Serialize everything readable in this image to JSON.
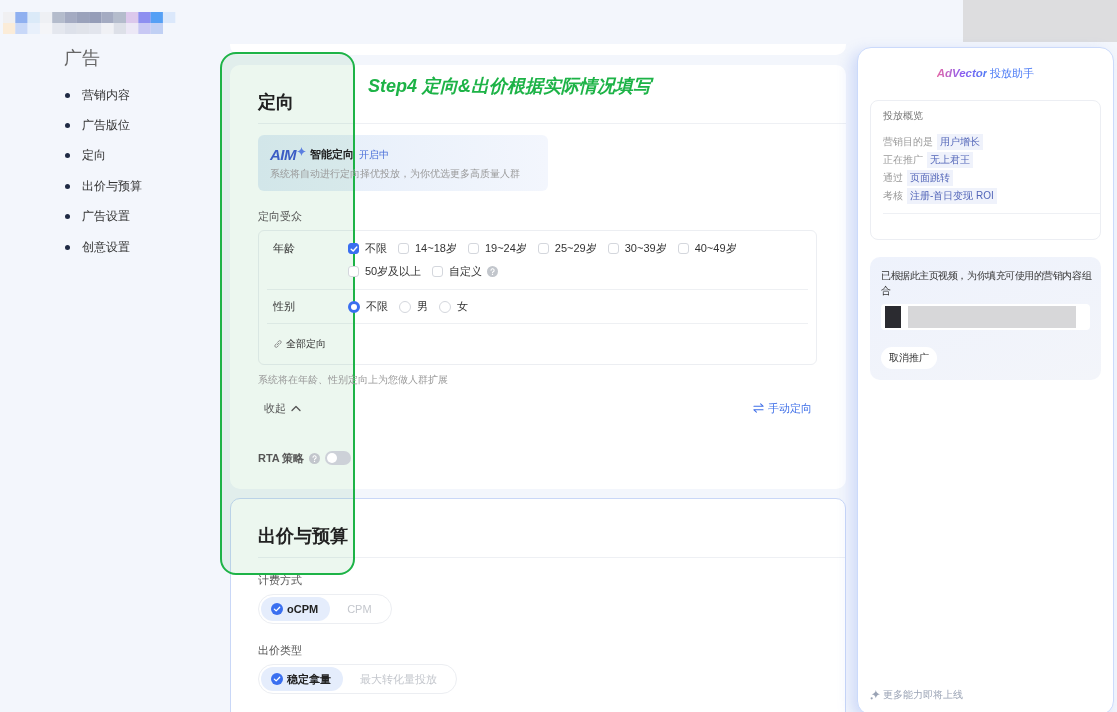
{
  "sidebar": {
    "title": "广告",
    "items": [
      "营销内容",
      "广告版位",
      "定向",
      "出价与预算",
      "广告设置",
      "创意设置"
    ]
  },
  "annotation": {
    "text": "Step4 定向&出价根据实际情况填写"
  },
  "targeting": {
    "title": "定向",
    "smart": {
      "logo": "AIM",
      "name": "智能定向",
      "status": "开启中",
      "description": "系统将自动进行定向择优投放，为你优选更多高质量人群"
    },
    "audience_label": "定向受众",
    "groups": [
      {
        "kind": "checkbox",
        "label": "年龄",
        "options": [
          {
            "label": "不限",
            "checked": true,
            "help": false
          },
          {
            "label": "14~18岁",
            "checked": false,
            "help": false
          },
          {
            "label": "19~24岁",
            "checked": false,
            "help": false
          },
          {
            "label": "25~29岁",
            "checked": false,
            "help": false
          },
          {
            "label": "30~39岁",
            "checked": false,
            "help": false
          },
          {
            "label": "40~49岁",
            "checked": false,
            "help": false
          },
          {
            "label": "50岁及以上",
            "checked": false,
            "help": false
          },
          {
            "label": "自定义",
            "checked": false,
            "help": true
          }
        ]
      },
      {
        "kind": "radio",
        "label": "性别",
        "options": [
          {
            "label": "不限",
            "selected": true
          },
          {
            "label": "男",
            "selected": false
          },
          {
            "label": "女",
            "selected": false
          }
        ]
      }
    ],
    "all_targeting": "全部定向",
    "expand_note": "系统将在年龄、性别定向上为您做人群扩展",
    "collapse": "收起",
    "manual": "手动定向",
    "rta": {
      "label": "RTA 策略",
      "on": false
    }
  },
  "bidding": {
    "title": "出价与预算",
    "groups": [
      {
        "label": "计费方式",
        "options": [
          {
            "label": "oCPM",
            "selected": true
          },
          {
            "label": "CPM",
            "selected": false
          }
        ]
      },
      {
        "label": "出价类型",
        "options": [
          {
            "label": "稳定拿量",
            "selected": true
          },
          {
            "label": "最大转化量投放",
            "selected": false
          }
        ]
      }
    ]
  },
  "assistant": {
    "brand": "AdVector",
    "title": "投放助手",
    "overview": {
      "title": "投放概览",
      "rows": [
        {
          "label": "营销目的是",
          "value": "用户增长"
        },
        {
          "label": "正在推广",
          "value": "无上君王"
        },
        {
          "label": "通过",
          "value": "页面跳转"
        },
        {
          "label": "考核",
          "value": "注册-首日变现 ROI"
        }
      ]
    },
    "suggestion": {
      "text": "已根据此主页视频，为你填充可使用的营销内容组合",
      "cancel": "取消推广"
    },
    "footer": "更多能力即将上线"
  }
}
